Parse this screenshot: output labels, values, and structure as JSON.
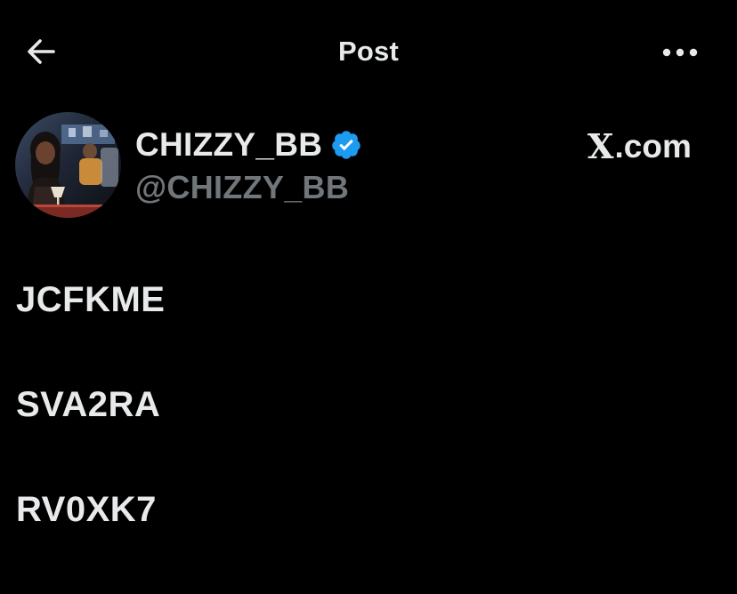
{
  "header": {
    "title": "Post",
    "back_icon": "arrow-left-icon",
    "more_icon": "more-horizontal-icon"
  },
  "author": {
    "display_name": "CHIZZY_BB",
    "handle": "@CHIZZY_BB",
    "verified": true,
    "verified_color": "#1d9bf0"
  },
  "source": {
    "logo_letter": "X",
    "suffix": ".com"
  },
  "post": {
    "lines": [
      "JCFKME",
      "SVA2RA",
      "RV0XK7"
    ]
  },
  "colors": {
    "background": "#000000",
    "primary_text": "#e7e9ea",
    "secondary_text": "#71767b",
    "accent": "#1d9bf0"
  }
}
